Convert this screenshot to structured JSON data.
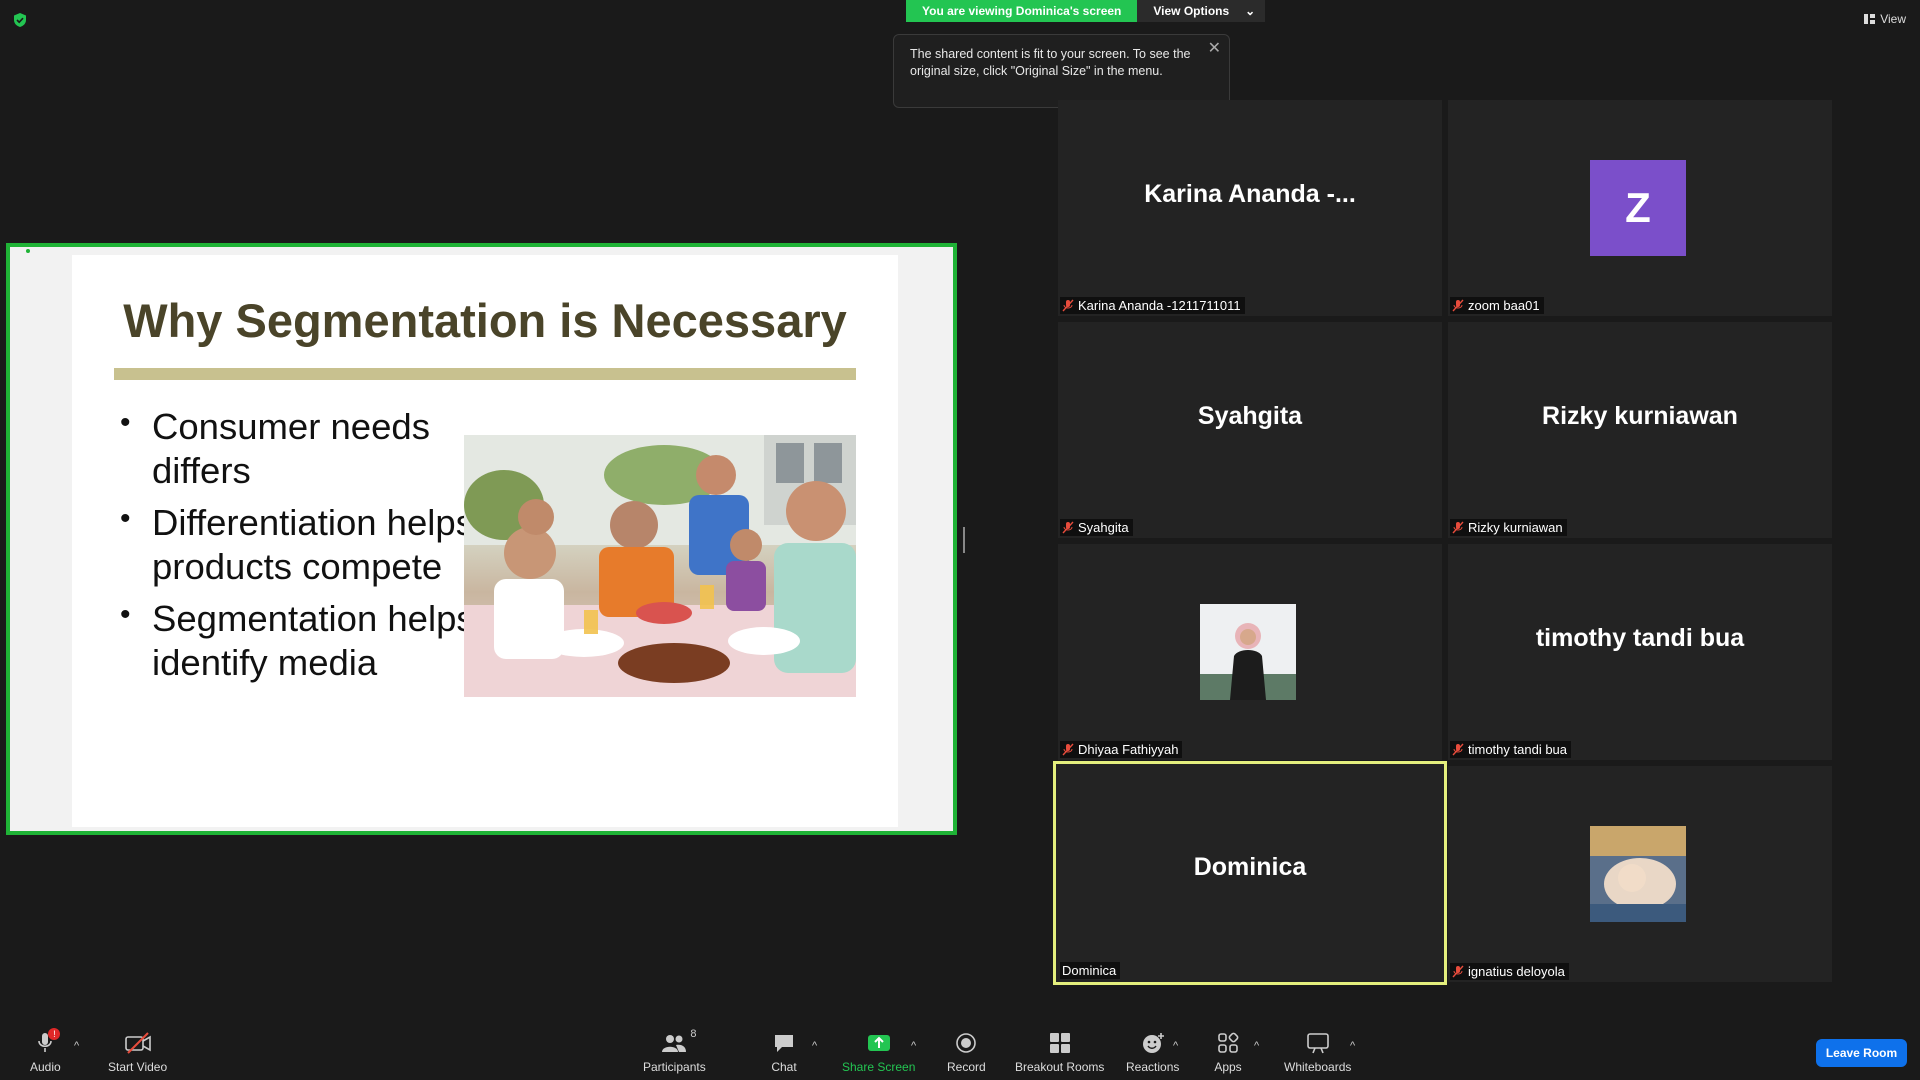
{
  "banner": {
    "viewing_text": "You are viewing Dominica's screen",
    "options_label": "View Options"
  },
  "top_view_label": "View",
  "tooltip": {
    "text": "The shared content is fit to your screen. To see the original size, click \"Original Size\" in the menu."
  },
  "slide": {
    "title": "Why Segmentation is Necessary",
    "bullets": [
      {
        "line1": "Consumer needs",
        "line2": "differs"
      },
      {
        "line1": "Differentiation helps",
        "line2": "products compete"
      },
      {
        "line1": "Segmentation helps",
        "line2": "identify media"
      }
    ]
  },
  "tiles": [
    {
      "display": "Karina Ananda -...",
      "label": "Karina Ananda -1211711011",
      "muted": true
    },
    {
      "display": "Z",
      "label": "zoom baa01",
      "muted": true
    },
    {
      "display": "Syahgita",
      "label": "Syahgita",
      "muted": true
    },
    {
      "display": "Rizky kurniawan",
      "label": "Rizky kurniawan",
      "muted": true
    },
    {
      "display": "",
      "label": "Dhiyaa Fathiyyah",
      "muted": true
    },
    {
      "display": "timothy tandi bua",
      "label": "timothy tandi bua",
      "muted": true
    },
    {
      "display": "Dominica",
      "label": "Dominica",
      "muted": false
    },
    {
      "display": "",
      "label": "ignatius deloyola",
      "muted": true
    }
  ],
  "toolbar": {
    "audio": "Audio",
    "audio_badge": "!",
    "start_video": "Start Video",
    "participants": "Participants",
    "participants_count": "8",
    "chat": "Chat",
    "share_screen": "Share Screen",
    "record": "Record",
    "breakout_rooms": "Breakout Rooms",
    "reactions": "Reactions",
    "apps": "Apps",
    "whiteboards": "Whiteboards",
    "leave_room": "Leave Room"
  },
  "colors": {
    "share_green": "#23c552",
    "active_speaker": "#e4ef7d",
    "leave_blue": "#0e71eb",
    "avatar_purple": "#7b4fca"
  }
}
